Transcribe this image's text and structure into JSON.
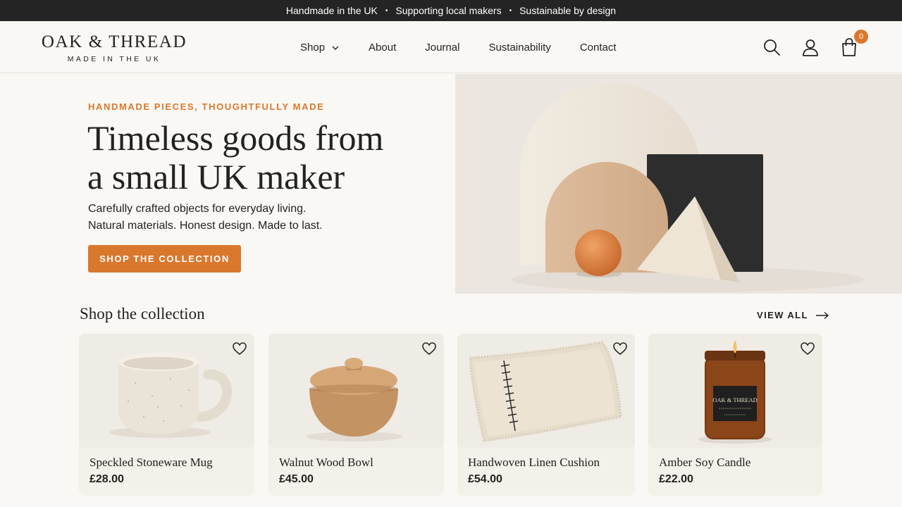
{
  "announcement": {
    "items": [
      "Handmade in the UK",
      "Supporting local makers",
      "Sustainable by design"
    ],
    "separator": "•"
  },
  "brand": {
    "name": "OAK & THREAD",
    "tagline": "MADE IN THE UK"
  },
  "nav": {
    "items": [
      {
        "label": "Shop",
        "has_dropdown": true
      },
      {
        "label": "About"
      },
      {
        "label": "Journal"
      },
      {
        "label": "Sustainability"
      },
      {
        "label": "Contact"
      }
    ]
  },
  "header_icons": {
    "search": "search-icon",
    "account": "user-icon",
    "cart": "shopping-bag-icon",
    "cart_count": "0"
  },
  "hero": {
    "eyebrow": "HANDMADE PIECES, THOUGHTFULLY MADE",
    "title_line1": "Timeless goods from",
    "title_line2": "a small UK maker",
    "copy_line1": "Carefully crafted objects for everyday living.",
    "copy_line2": "Natural materials. Honest design. Made to last.",
    "cta": "SHOP THE COLLECTION"
  },
  "collection": {
    "title": "Shop the collection",
    "view_all": "VIEW ALL",
    "products": [
      {
        "name": "Speckled Stoneware Mug",
        "price": "£28.00"
      },
      {
        "name": "Walnut Wood Bowl",
        "price": "£45.00"
      },
      {
        "name": "Handwoven Linen Cushion",
        "price": "£54.00"
      },
      {
        "name": "Amber Soy Candle",
        "price": "£22.00"
      }
    ]
  },
  "colors": {
    "accent": "#d9782d",
    "dark": "#242424",
    "background": "#faf8f4"
  },
  "candle_label": "OAK & THREAD"
}
